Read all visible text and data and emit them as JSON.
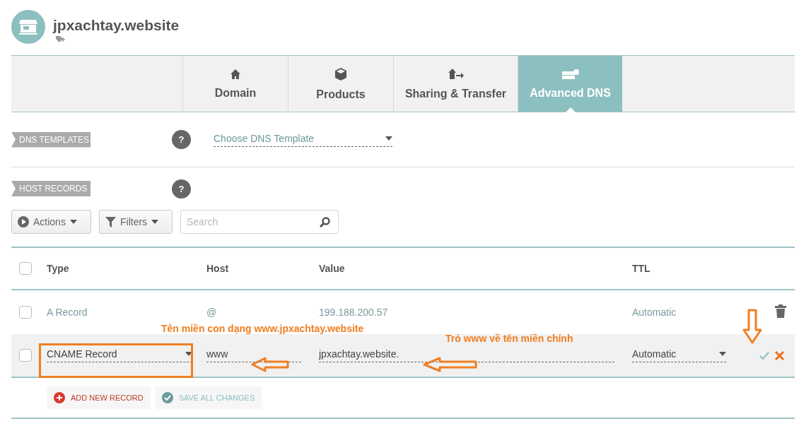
{
  "header": {
    "title": "jpxachtay.website"
  },
  "tabs": [
    {
      "label": "Domain",
      "selected": false
    },
    {
      "label": "Products",
      "selected": false
    },
    {
      "label": "Sharing & Transfer",
      "selected": false
    },
    {
      "label": "Advanced DNS",
      "selected": true
    }
  ],
  "dns_templates": {
    "label": "DNS TEMPLATES",
    "help": "?",
    "select": "Choose DNS Template"
  },
  "host_records": {
    "label": "HOST RECORDS",
    "help": "?"
  },
  "toolbar": {
    "actions": "Actions",
    "filters": "Filters",
    "search": {
      "placeholder": "Search"
    }
  },
  "table": {
    "select_all_checked": false,
    "columns": [
      "Type",
      "Host",
      "Value",
      "TTL"
    ],
    "rows": [
      {
        "kind": "view",
        "checked": false,
        "type": "A Record",
        "host": "@",
        "value": "199.188.200.57",
        "ttl": "Automatic"
      },
      {
        "kind": "edit",
        "checked": false,
        "type": "CNAME Record",
        "host": "www",
        "value": "jpxachtay.website.",
        "ttl": "Automatic"
      }
    ]
  },
  "footer": {
    "add": "ADD NEW RECORD",
    "save": "SAVE ALL CHANGES"
  },
  "annotations": [
    "Tên miền con dạng www.jpxachtay.website",
    "Trỏ www về tên miền chính"
  ]
}
